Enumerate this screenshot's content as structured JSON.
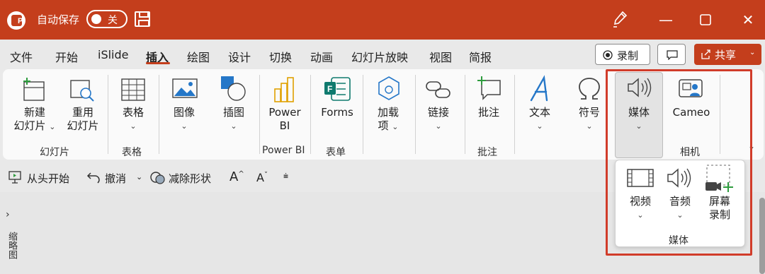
{
  "title_bar": {
    "autosave_label": "自动保存",
    "autosave_state": "关",
    "accent_color": "#c43e1c",
    "icons": [
      "powerpoint-logo-icon",
      "save-icon",
      "pen-icon",
      "minimize-icon",
      "maximize-icon",
      "close-icon"
    ]
  },
  "tabs": [
    "文件",
    "开始",
    "iSlide",
    "插入",
    "绘图",
    "设计",
    "切换",
    "动画",
    "幻灯片放映",
    "视图",
    "简报"
  ],
  "active_tab": "插入",
  "header_buttons": {
    "record_label": "录制",
    "share_label": "共享"
  },
  "ribbon": {
    "new_slide": {
      "line1": "新建",
      "line2": "幻灯片"
    },
    "reuse_slide": {
      "line1": "重用",
      "line2": "幻灯片"
    },
    "slides_group": "幻灯片",
    "table": "表格",
    "table_group": "表格",
    "image": "图像",
    "illustration": "插图",
    "powerbi": {
      "line1": "Power",
      "line2": "BI"
    },
    "powerbi_group": "Power BI",
    "forms": "Forms",
    "forms_group": "表单",
    "addins": {
      "line1": "加载",
      "line2": "项"
    },
    "link": "链接",
    "comment": "批注",
    "comment_group": "批注",
    "text": "文本",
    "symbol": "符号",
    "media": "媒体",
    "cameo": "Cameo",
    "camera_group": "相机"
  },
  "quick_access": {
    "from_start": "从头开始",
    "undo": "撤消",
    "reduce_shapes": "减除形状"
  },
  "media_dropdown": {
    "video": "视频",
    "audio": "音频",
    "screen_record": {
      "line1": "屏幕",
      "line2": "录制"
    },
    "group_label": "媒体"
  },
  "thumbnail_pane_label": "缩略图"
}
